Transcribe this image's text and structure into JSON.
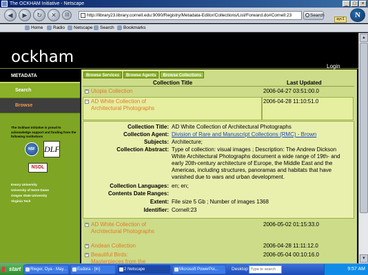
{
  "window": {
    "title": "The OCKHAM Initiative - Netscape"
  },
  "navbar": {
    "url": "http://library23.library.cornell.edu:9090/Registry/Metadata-Editor/Collections/List/Forward.do#Cornell:23",
    "search_label": "Search",
    "aim_tag": "ayc1"
  },
  "personal_toolbar": {
    "items": [
      "Home",
      "Radio",
      "Netscape",
      "Search",
      "Bookmarks"
    ]
  },
  "site": {
    "brand": "ockham",
    "login_label": "Login"
  },
  "sidebar": {
    "heading": "METADATA",
    "items": [
      {
        "label": "Search"
      },
      {
        "label": "Browse"
      }
    ],
    "institutions_text": "The Ockham Initiative is proud to acknowledge support and funding from the following institutions",
    "institution_list": [
      "Emory University",
      "University of Notre Dame",
      "Oregon State University",
      "Virginia Tech"
    ],
    "logos": {
      "nsf": "NSF",
      "dlf": "DLF",
      "nsdl": "NSDL"
    }
  },
  "tabs": [
    "Browse Services",
    "Browse Agents",
    "Browse Collections"
  ],
  "table": {
    "columns": [
      "Collection Title",
      "Last Updated"
    ],
    "rows_top": [
      {
        "title": "Utopia Collection",
        "updated": "2006-04-27 03:51:00.0"
      }
    ],
    "open_row": {
      "title": "AD White Collection of Architectural Photographs",
      "updated": "2006-04-28 11:10:51.0"
    },
    "rows_bottom": [
      {
        "title": "AD White Collection of Architectural Photographs",
        "updated": "2006-05-02 01:15:33.0"
      },
      {
        "title": "Andean Collection",
        "updated": "2006-04-28 11:11:12.0"
      },
      {
        "title": "Beautiful Birds: Masterpieces from the",
        "updated": "2006-05-04 00:10:16.0"
      }
    ]
  },
  "detail": {
    "collection_title": {
      "label": "Collection Title:",
      "value": "AD White Collection of Architectural Photographs"
    },
    "collection_agent": {
      "label": "Collection Agent:",
      "value": "Division of Rare and Manuscript Collections (RMC) - Brown"
    },
    "subjects": {
      "label": "Subjects:",
      "value": "Architecture;"
    },
    "abstract": {
      "label": "Collection Abstract:",
      "value": "Type of collection: visual images ; Description: The Andrew Dickson White Architectural Photographs document a wide range of 19th- and early 20th-century architecture of Europe, the Middle East and the Americas, including structures, panoramas and habitats that have vanished due to wars and urban development."
    },
    "languages": {
      "label": "Collection Languages:",
      "value": "en; en;"
    },
    "date_ranges": {
      "label": "Contents Date Ranges:",
      "value": ""
    },
    "extent": {
      "label": "Extent:",
      "value": "File size 5 Gb ; Number of images 1368"
    },
    "identifier": {
      "label": "Identifier:",
      "value": "Cornell:23"
    }
  },
  "taskbar": {
    "start_label": "start",
    "buttons": [
      "Rieger, Oya - May...",
      "Eudora - [In]",
      "2 Netscape",
      "Microsoft PowerPoi..."
    ],
    "desktop_label": "Desktop",
    "search_placeholder": "Type to search",
    "clock": "9:57 AM"
  }
}
